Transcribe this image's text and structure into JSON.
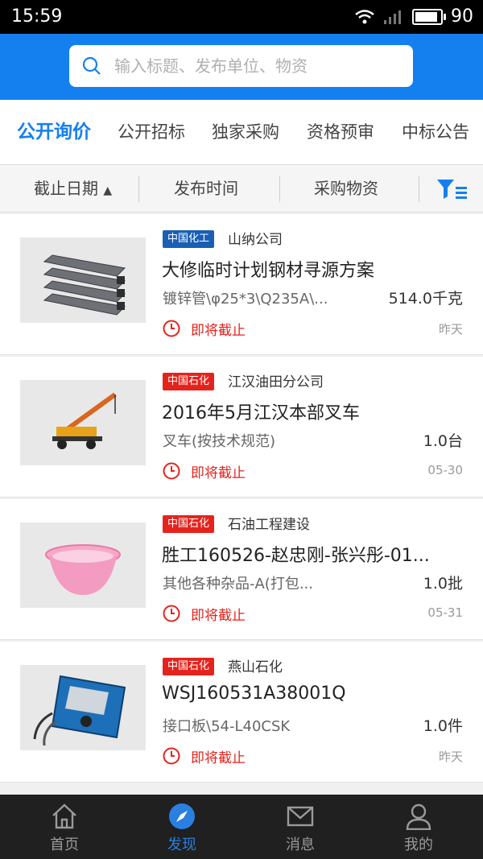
{
  "status_bar": {
    "time": "15:59",
    "battery": "90",
    "battery_level": 0.9
  },
  "search": {
    "placeholder": "输入标题、发布单位、物资"
  },
  "tabs": [
    {
      "label": "公开询价",
      "active": true
    },
    {
      "label": "公开招标"
    },
    {
      "label": "独家采购"
    },
    {
      "label": "资格预审"
    },
    {
      "label": "中标公告"
    }
  ],
  "sort": [
    {
      "label": "截止日期",
      "arrow": "▲"
    },
    {
      "label": "发布时间"
    },
    {
      "label": "采购物资"
    }
  ],
  "icons": {
    "filter": "filter-icon",
    "search": "search-icon",
    "clock": "clock-icon"
  },
  "colors": {
    "brand": "#1480f0",
    "badge_blue": "#1a5fb4",
    "badge_red": "#e5231d",
    "deadline": "#e5231d"
  },
  "items": [
    {
      "badge": "中国化工",
      "badge_color": "#1a5fb4",
      "company": "山纳公司",
      "title": "大修临时计划钢材寻源方案",
      "spec": "镀锌管\\φ25*3\\Q235A\\...",
      "qty": "514.0千克",
      "deadline": "即将截止",
      "date": "昨天"
    },
    {
      "badge": "中国石化",
      "badge_color": "#e5231d",
      "company": "江汉油田分公司",
      "title": "2016年5月江汉本部叉车",
      "spec": "叉车(按技术规范)",
      "qty": "1.0台",
      "deadline": "即将截止",
      "date": "05-30"
    },
    {
      "badge": "中国石化",
      "badge_color": "#e5231d",
      "company": "石油工程建设",
      "title": "胜工160526-赵忠刚-张兴彤-01...",
      "spec": "其他各种杂品-A(打包...",
      "qty": "1.0批",
      "deadline": "即将截止",
      "date": "05-31"
    },
    {
      "badge": "中国石化",
      "badge_color": "#e5231d",
      "company": "燕山石化",
      "title": "WSJ160531A38001Q",
      "spec": "接口板\\54-L40CSK",
      "qty": "1.0件",
      "deadline": "即将截止",
      "date": "昨天"
    }
  ],
  "nav": [
    {
      "label": "首页",
      "icon": "home-icon"
    },
    {
      "label": "发现",
      "icon": "compass-icon",
      "active": true
    },
    {
      "label": "消息",
      "icon": "mail-icon"
    },
    {
      "label": "我的",
      "icon": "user-icon"
    }
  ]
}
